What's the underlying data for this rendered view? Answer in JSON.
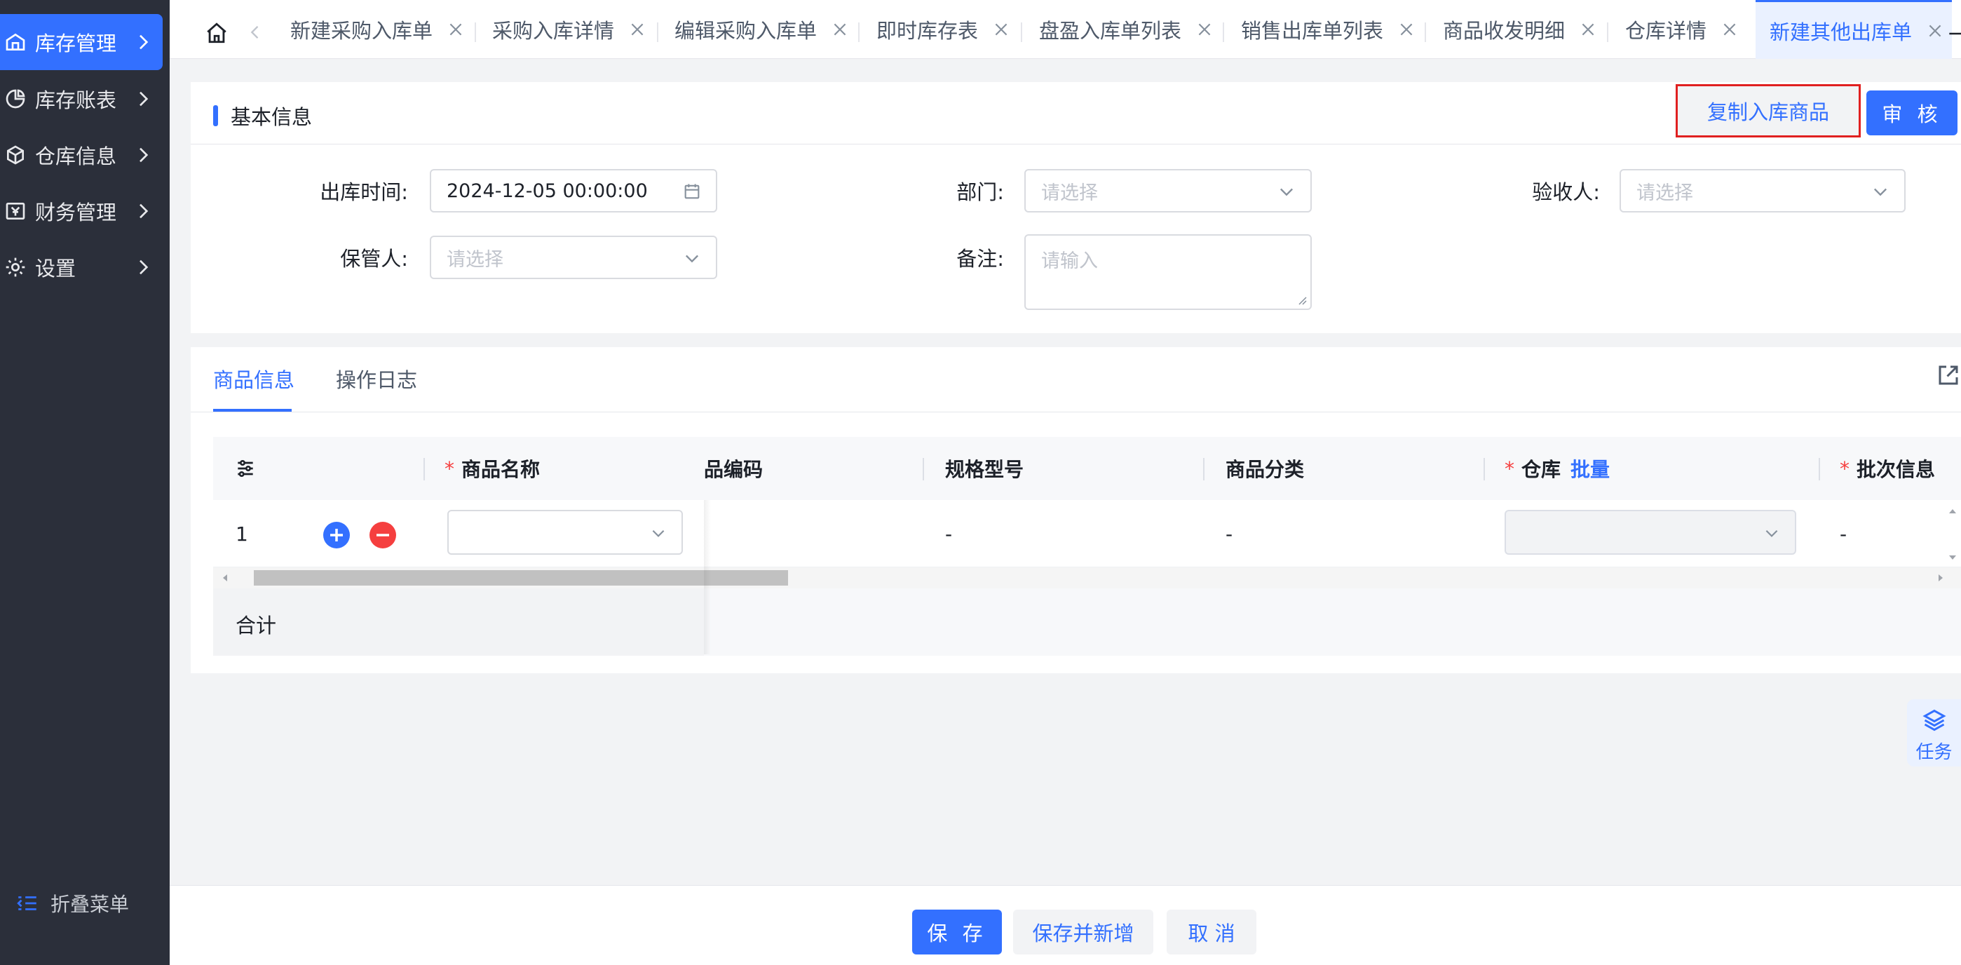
{
  "sidebar": {
    "items": [
      {
        "label": "库存管理"
      },
      {
        "label": "库存账表"
      },
      {
        "label": "仓库信息"
      },
      {
        "label": "财务管理"
      },
      {
        "label": "设置"
      }
    ],
    "collapse_label": "折叠菜单"
  },
  "tabs": [
    {
      "label": "新建采购入库单"
    },
    {
      "label": "采购入库详情"
    },
    {
      "label": "编辑采购入库单"
    },
    {
      "label": "即时库存表"
    },
    {
      "label": "盘盈入库单列表"
    },
    {
      "label": "销售出库单列表"
    },
    {
      "label": "商品收发明细"
    },
    {
      "label": "仓库详情"
    },
    {
      "label": "新建其他出库单"
    }
  ],
  "basic": {
    "title": "基本信息",
    "copy_button": "复制入库商品",
    "audit_button": "审 核",
    "fields": {
      "outbound_time": {
        "label": "出库时间:",
        "value": "2024-12-05 00:00:00"
      },
      "department": {
        "label": "部门:",
        "placeholder": "请选择"
      },
      "inspector": {
        "label": "验收人:",
        "placeholder": "请选择"
      },
      "keeper": {
        "label": "保管人:",
        "placeholder": "请选择"
      },
      "remark": {
        "label": "备注:",
        "placeholder": "请输入"
      }
    }
  },
  "detail": {
    "tabs": [
      {
        "label": "商品信息"
      },
      {
        "label": "操作日志"
      }
    ],
    "columns": {
      "name": "商品名称",
      "code": "品编码",
      "spec": "规格型号",
      "category": "商品分类",
      "warehouse": "仓库",
      "batch_link": "批量",
      "batch_info": "批次信息"
    },
    "row": {
      "index": "1",
      "spec": "-",
      "category": "-",
      "batch_info": "-"
    },
    "sum_label": "合计"
  },
  "task_label": "任务",
  "footer": {
    "save": "保 存",
    "save_new": "保存并新增",
    "cancel": "取 消"
  },
  "colors": {
    "accent": "#3370ff",
    "sidebar_bg": "#2b2f3a",
    "danger": "#f53f3f",
    "highlight_border": "#e02020"
  }
}
